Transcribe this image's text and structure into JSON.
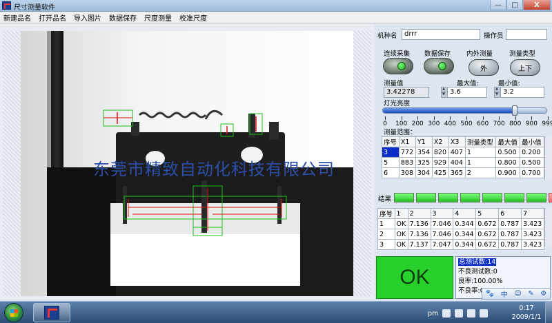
{
  "window": {
    "title": "尺寸测量软件",
    "controls": [
      "—",
      "□",
      "X"
    ]
  },
  "menu": [
    "新建品名",
    "打开品名",
    "导入图片",
    "数据保存",
    "尺度测量",
    "校准尺度"
  ],
  "watermark": "东莞市精致自动化科技有限公司",
  "panel": {
    "machine_label": "机种名",
    "machine_value": "drrr",
    "operator_label": "操作员",
    "operator_value": "",
    "btn_capture_label": "连续采集",
    "btn_save_label": "数据保存",
    "inner_outer_label": "内外测量",
    "inner_outer_value": "外",
    "measure_type_label": "测量类型",
    "measure_type_value": "上下",
    "measured_label": "测量值",
    "measured_value": "3.42278",
    "max_label": "最大值:",
    "max_value": "3.6",
    "min_label": "最小值:",
    "min_value": "3.2",
    "light_label": "灯光亮度",
    "light_level": 800,
    "light_max": 1000,
    "scale": [
      "0",
      "100",
      "200",
      "300",
      "400",
      "500",
      "600",
      "700",
      "800",
      "900",
      "999"
    ],
    "range_label": "测量范围：",
    "result_label": "结果"
  },
  "range_table": {
    "headers": [
      "序号",
      "X1",
      "Y1",
      "X2",
      "X3",
      "测量类型",
      "最大值",
      "最小值"
    ],
    "rows": [
      [
        "3",
        "772",
        "354",
        "820",
        "407",
        "1",
        "0.500",
        "0.200"
      ],
      [
        "5",
        "883",
        "325",
        "929",
        "404",
        "1",
        "0.800",
        "0.500"
      ],
      [
        "6",
        "308",
        "304",
        "425",
        "365",
        "2",
        "0.900",
        "0.700"
      ]
    ]
  },
  "results": [
    "ok",
    "ok",
    "ok",
    "ok",
    "ok",
    "ok",
    "ok",
    "ng"
  ],
  "record_table": {
    "headers": [
      "序号",
      "1",
      "2",
      "3",
      "4",
      "5",
      "6",
      "7"
    ],
    "rows": [
      [
        "1",
        "OK",
        "7.136",
        "7.046",
        "0.344",
        "0.672",
        "0.787",
        "3.423"
      ],
      [
        "2",
        "OK",
        "7.136",
        "7.046",
        "0.344",
        "0.672",
        "0.787",
        "3.423"
      ],
      [
        "3",
        "OK",
        "7.137",
        "7.047",
        "0.344",
        "0.672",
        "0.787",
        "3.423"
      ]
    ]
  },
  "ok_label": "OK",
  "stats": {
    "total": "总测试数:14",
    "bad": "不良测试数:0",
    "yield": "良率:100.00%",
    "bad_rate": "不良率:0"
  },
  "ime": [
    "中",
    "☺",
    "✎",
    "⚙"
  ],
  "taskbar": {
    "tray_text": "pm",
    "time": "0:17",
    "date": "2009/1/1"
  },
  "colors": {
    "ok_green": "#28d02c",
    "selection_blue": "#0a2dc7",
    "measure_red": "#e01010",
    "roi_green": "#18c018"
  }
}
